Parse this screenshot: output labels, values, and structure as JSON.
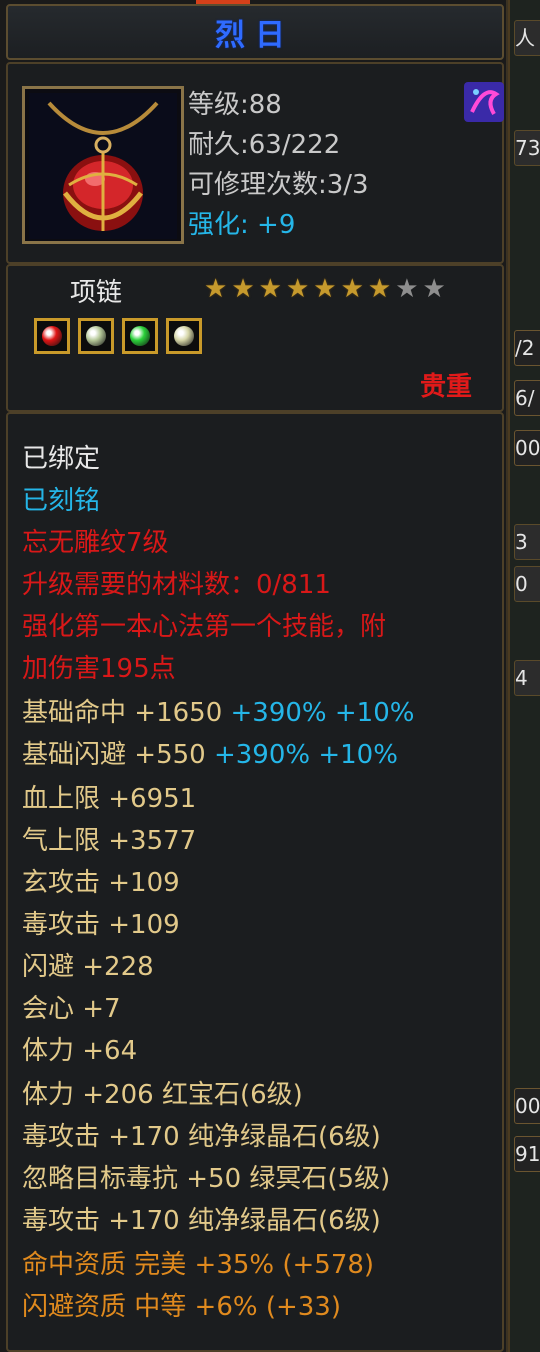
{
  "item": {
    "name": "烈日",
    "level": "等级:88",
    "durability": "耐久:63/222",
    "repair": "可修理次数:3/3",
    "enhance_label": "强化:",
    "enhance_value": "+9"
  },
  "type_panel": {
    "type": "项链",
    "stars_lit": 7,
    "stars_total": 9,
    "rarity": "贵重",
    "sockets": [
      {
        "gem": "red-gem-icon",
        "color": "#e01515"
      },
      {
        "gem": "pale-gem-icon",
        "color": "#b7c99a"
      },
      {
        "gem": "green-gem-icon",
        "color": "#2bd13a"
      },
      {
        "gem": "pale-gem-icon",
        "color": "#d6d6a8"
      }
    ]
  },
  "attributes": {
    "bound": "已绑定",
    "engraved": "已刻铭",
    "red_lines": [
      "忘无雕纹7级",
      "升级需要的材料数：0/811",
      "强化第一本心法第一个技能，附",
      "加伤害195点"
    ],
    "base_hit": {
      "label": "基础命中",
      "value": "+1650",
      "pct1": "+390%",
      "pct2": "+10%"
    },
    "base_dodge": {
      "label": "基础闪避",
      "value": "+550",
      "pct1": "+390%",
      "pct2": "+10%"
    },
    "gold_lines": [
      "血上限 +6951",
      "气上限 +3577",
      "玄攻击 +109",
      "毒攻击 +109",
      "闪避 +228",
      "会心 +7",
      "体力 +64",
      "体力 +206 红宝石(6级)",
      "毒攻击 +170 纯净绿晶石(6级)",
      "忽略目标毒抗 +50 绿冥石(5级)",
      "毒攻击 +170 纯净绿晶石(6级)"
    ],
    "orange_lines": [
      "命中资质   完美 +35% (+578)",
      "闪避资质   中等 +6% (+33)"
    ]
  },
  "background_ui": {
    "cells": [
      "人",
      "73",
      "/2",
      "6/",
      "00",
      "3",
      "0",
      "4",
      "00",
      "91"
    ]
  }
}
